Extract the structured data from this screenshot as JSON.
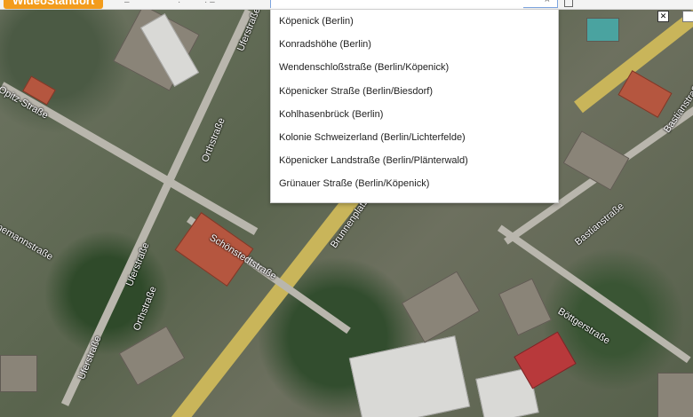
{
  "app": {
    "logo_text": "WideoStandort",
    "toolbar_items": [
      "–",
      "·",
      "· –"
    ]
  },
  "search": {
    "value": "",
    "placeholder": "",
    "clear_icon": "close-icon"
  },
  "suggestions": [
    "Köpenick (Berlin)",
    "Konradshöhe (Berlin)",
    "Wendenschloßstraße (Berlin/Köpenick)",
    "Köpenicker Straße (Berlin/Biesdorf)",
    "Kohlhasenbrück (Berlin)",
    "Kolonie Schweizerland (Berlin/Lichterfelde)",
    "Köpenicker Landstraße (Berlin/Plänterwald)",
    "Grünauer Straße (Berlin/Köpenick)"
  ],
  "map": {
    "streets": {
      "opitz": "Opitz-Straße",
      "ufer_top": "Uferstraße",
      "orth_top": "Orthstraße",
      "schoenstedt": "Schönstedtstraße",
      "brunnenplatz": "Brunnenplatz",
      "ufer_bottom_left": "Uferstraße",
      "orth_bottom": "Orthstraße",
      "ufer_bottom": "Uferstraße",
      "manna": "nemannstraße",
      "bastian": "Bastianstraße",
      "boettger": "Böttgerstraße",
      "right_edge": "Bastianstraße"
    }
  },
  "controls": {
    "close_label": "✕"
  }
}
